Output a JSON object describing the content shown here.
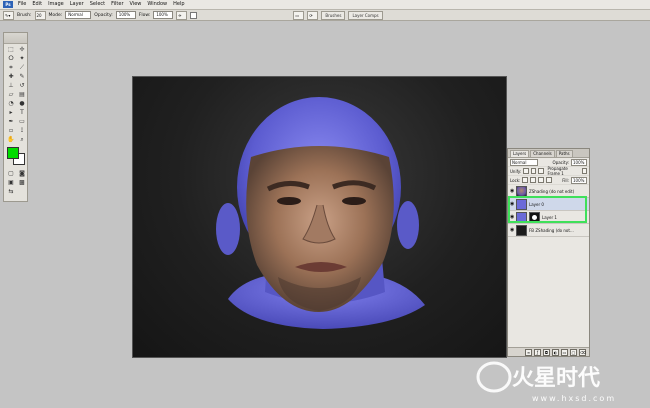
{
  "menu": [
    "File",
    "Edit",
    "Image",
    "Layer",
    "Select",
    "Filter",
    "View",
    "Window",
    "Help"
  ],
  "options_bar": {
    "mode_label": "Mode:",
    "mode_value": "Normal",
    "opacity_label": "Opacity:",
    "opacity_value": "100%",
    "flow_label": "Flow:",
    "flow_value": "100%",
    "brush_label": "Brush:",
    "brush_size": "20",
    "chip1": "Brushes",
    "chip2": "Layer Comps"
  },
  "colors": {
    "foreground": "#00dd00",
    "background": "#ffffff",
    "highlight": "#3fe05a"
  },
  "layers_panel": {
    "tabs": [
      "Layers",
      "Channels",
      "Paths"
    ],
    "blend_mode": "Normal",
    "opacity_label": "Opacity:",
    "opacity_value": "100%",
    "lock_label": "Lock:",
    "fill_label": "Fill:",
    "fill_value": "100%",
    "unify_label": "Unify:",
    "propagate_label": "Propagate Frame 1",
    "rows": [
      {
        "name": "ZShading (do not edit)",
        "thumb": "face"
      },
      {
        "name": "Layer 0",
        "thumb": "blue"
      },
      {
        "name": "Layer 1",
        "thumb": "mask"
      },
      {
        "name": "FB ZShading (do not...",
        "thumb": "dark"
      }
    ]
  },
  "watermark": {
    "brand": "火星时代",
    "url": "www.hxsd.com"
  }
}
